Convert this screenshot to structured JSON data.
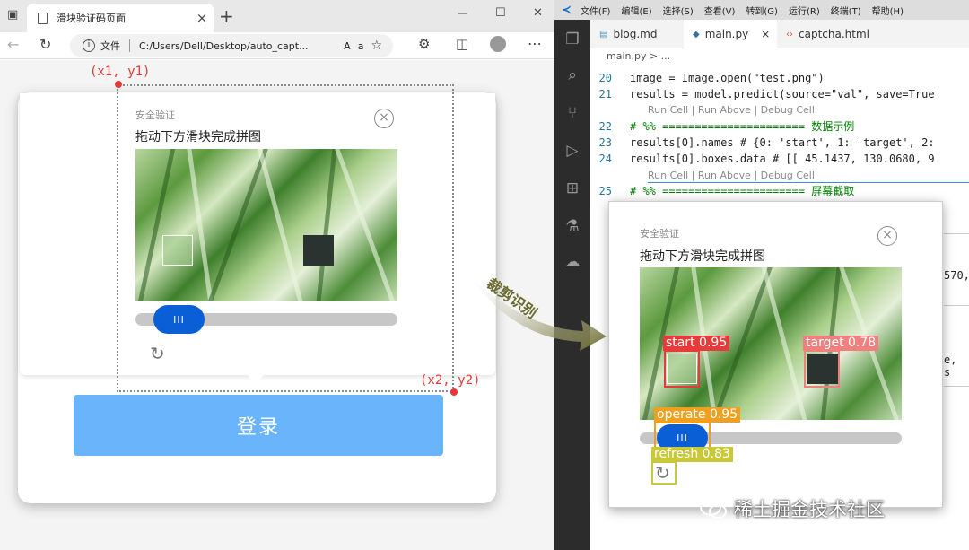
{
  "browser": {
    "tab_title": "滑块验证码页面",
    "tab_close": "×",
    "new_tab": "+",
    "window_controls": {
      "minimize": "—",
      "maximize": "☐",
      "close": "✕"
    },
    "address_label": "文件",
    "url": "C:/Users/Dell/Desktop/auto_capt...",
    "toolbar_icons": [
      "back-arrow-icon",
      "reload-icon",
      "info-icon",
      "read-aloud-icon",
      "translate-icon",
      "favorite-star-icon",
      "extensions-icon",
      "split-screen-icon",
      "profile-icon",
      "more-icon"
    ]
  },
  "captcha": {
    "small_title": "安全验证",
    "main_title": "拖动下方滑块完成拼图",
    "knob_label": "III",
    "close_symbol": "×",
    "refresh_symbol": "↻"
  },
  "login": {
    "button_label": "登录"
  },
  "annotations": {
    "top_left": "(x1, y1)",
    "bottom_right": "(x2, y2)",
    "arrow_label": "裁剪识别"
  },
  "vscode": {
    "menu": [
      "文件(F)",
      "编辑(E)",
      "选择(S)",
      "查看(V)",
      "转到(G)",
      "运行(R)",
      "终端(T)",
      "帮助(H)"
    ],
    "tabs": [
      "blog.md",
      "main.py",
      "captcha.html"
    ],
    "active_tab": "main.py",
    "breadcrumb": "main.py > ...",
    "code_lines": [
      {
        "num": "20",
        "text": "image = Image.open(\"test.png\")"
      },
      {
        "num": "21",
        "text": "results = model.predict(source=\"val\",  save=True"
      },
      {
        "num": "22",
        "text": "# %% ====================== 数据示例"
      },
      {
        "num": "23",
        "text": "results[0].names # {0: 'start', 1: 'target', 2:"
      },
      {
        "num": "24",
        "text": "results[0].boxes.data # [[ 45.1437, 130.0680,  9"
      },
      {
        "num": "25",
        "text": "# %% ====================== 屏幕截取"
      }
    ],
    "codelens": "Run Cell | Run Above | Debug Cell",
    "right_fragments": [
      "570,",
      "e,  s"
    ]
  },
  "detections": [
    {
      "label": "start 0.95",
      "color": "#e53b3b"
    },
    {
      "label": "target 0.78",
      "color": "#f08080"
    },
    {
      "label": "operate 0.95",
      "color": "#f0a020"
    },
    {
      "label": "refresh 0.83",
      "color": "#c8c83a"
    }
  ],
  "watermark": "稀土掘金技术社区"
}
